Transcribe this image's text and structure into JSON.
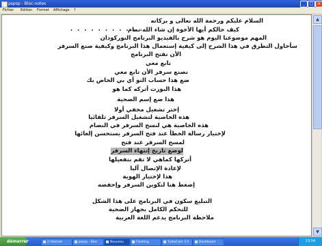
{
  "window": {
    "title": "pspsp - Bloc-notes"
  },
  "menu": [
    "Fichier",
    "Edition",
    "Format",
    "Affichage",
    "?"
  ],
  "document": {
    "lines": [
      "السلام عليكم ورحمة الله تعالى و بركاته",
      "كيف حالكم أيها الأخوة إن شاء الله تمام",
      "المهم موضوعنا اليوم هو شرح بالفيديو البرنامج التوركودان",
      "سأحاول التطرق في هذا الشرح إلى كيفية إستعمال هذا البرنامج وكيفية صنع السرفر",
      "الأن نفتح البرنامج",
      "تابع معي",
      "نصنع سرفر الأن تابع معي",
      "ضع هذا حساب النو أي بي الخاص بك",
      "هذا البورت أتركه كما هو",
      "هذا ضع إسم الضحية",
      "إختر تشغيل مخفي أولا",
      "هذه الخاصية لتشغيل السرفر تلقائيا",
      "هذه الخاصية هي لنسخ السرفر في النضام",
      "لإختيار رسالة الخطأ عند فتح السرفر يستحسن إلغائها",
      "لمسح السرفر عند فتح",
      "لوضع تاريخ إنتهاء السرفر",
      "أتركها كماهي لا تقم بتفعيلها",
      "لإعادة الإتصال آليا",
      "هذا لإختيار الهوية",
      "إضغط هنا لتكوين السرفر وإحفضه",
      "",
      "التبليغ سكون في البرنامج على هذا الشكل",
      "للتحكم الكامل بجهاز الضحية",
      "ملاحظة البرنامج يدعم اللغة العربية"
    ],
    "dots": ". . . . . . . . . . ."
  },
  "taskbar": {
    "start_label": "démarrer",
    "tasks": [
      "2 Internet",
      "pspsp - Bloc",
      "Nouveau",
      "Flashing",
      "TurboCam 3.0",
      "Dashboard"
    ],
    "clock": "13:54"
  }
}
